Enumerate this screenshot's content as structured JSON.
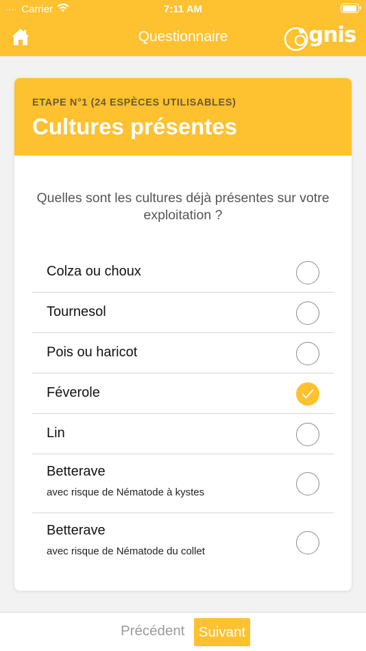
{
  "status_bar": {
    "carrier": "Carrier",
    "signal_dots": "....",
    "time": "7:11 AM"
  },
  "nav": {
    "title": "Questionnaire",
    "logo_text": "gnis",
    "home_icon": "home-icon"
  },
  "card": {
    "step_label": "ETAPE N°1 (24 ESPÈCES UTILISABLES)",
    "title": "Cultures présentes",
    "question": "Quelles sont les cultures déjà présentes sur votre exploitation ?"
  },
  "options": [
    {
      "label": "Colza ou choux",
      "sub": "",
      "checked": false
    },
    {
      "label": "Tournesol",
      "sub": "",
      "checked": false
    },
    {
      "label": "Pois ou haricot",
      "sub": "",
      "checked": false
    },
    {
      "label": "Féverole",
      "sub": "",
      "checked": true
    },
    {
      "label": "Lin",
      "sub": "",
      "checked": false
    },
    {
      "label": "Betterave",
      "sub": "avec risque de Nématode à kystes",
      "checked": false
    },
    {
      "label": "Betterave",
      "sub": "avec risque de Nématode du collet",
      "checked": false
    }
  ],
  "footer": {
    "prev_label": "Précédent",
    "next_label": "Suivant"
  },
  "colors": {
    "accent": "#fec12f",
    "background": "#f2f2f2"
  }
}
